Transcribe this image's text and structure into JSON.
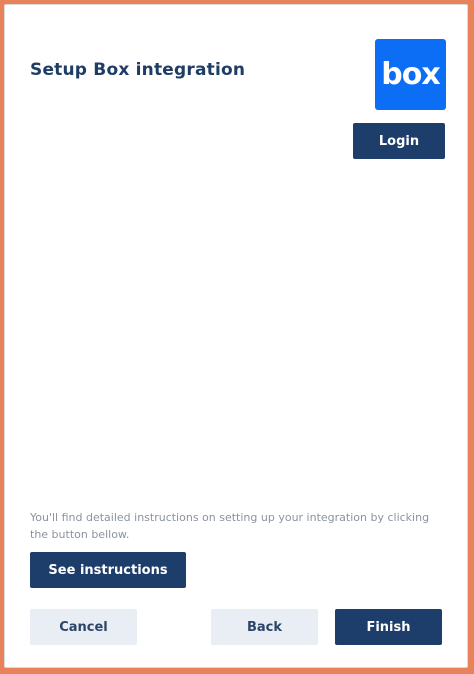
{
  "dialog": {
    "title": "Setup Box integration",
    "logo_text": "box",
    "login_label": "Login",
    "instructions_note": "You'll find detailed instructions on setting up your integration by clicking the button bellow.",
    "see_instructions_label": "See instructions"
  },
  "footer": {
    "cancel_label": "Cancel",
    "back_label": "Back",
    "finish_label": "Finish"
  },
  "colors": {
    "primary_button": "#1d3d6b",
    "secondary_button": "#e8eef4",
    "box_brand": "#0b6ef5",
    "title": "#1f3d64"
  }
}
